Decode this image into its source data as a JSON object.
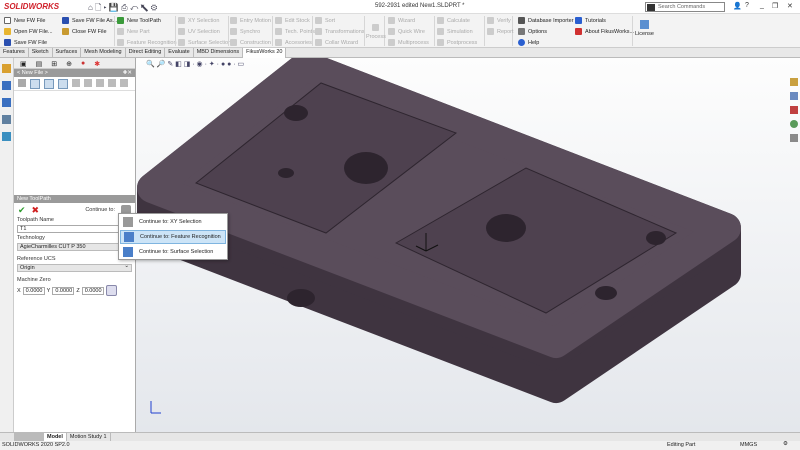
{
  "app": {
    "logo": "SOLIDWORKS",
    "document_title": "592-2931 edited New1.SLDPRT *",
    "search_placeholder": "Search Commands"
  },
  "ribbon": {
    "file": [
      "New FW File",
      "Open FW File...",
      "Save FW File"
    ],
    "file2": [
      "Save FW File As...",
      "Close FW File"
    ],
    "toolpath": [
      "New ToolPath",
      "New Part",
      "Feature Recognition"
    ],
    "selection": [
      "XY Selection",
      "UV Selection",
      "Surface Selection"
    ],
    "motion": [
      "Entry Motion",
      "Synchro",
      "Construction"
    ],
    "stock": [
      "Edit Stock",
      "Tech. Points",
      "Accesories"
    ],
    "sort": [
      "Sort",
      "Transformations",
      "Collar Wizard"
    ],
    "process": "Process",
    "wizard": [
      "Wizard",
      "Quick Wire",
      "Multiprocess"
    ],
    "calc": [
      "Calculate",
      "Simulation",
      "Postprocess"
    ],
    "verify": [
      "Verify",
      "Report"
    ],
    "db": [
      "Database Importer",
      "Options",
      "Help"
    ],
    "tut": [
      "Tutorials",
      "About FikusWorks..."
    ],
    "license": "License"
  },
  "tabs": [
    "Features",
    "Sketch",
    "Surfaces",
    "Mesh Modeling",
    "Direct Editing",
    "Evaluate",
    "MBD Dimensions",
    "FikusWorks 20"
  ],
  "active_tab": "FikusWorks 20",
  "panel": {
    "file_header": "< New File >",
    "toolpath_header": "New ToolPath",
    "continue_label": "Continue to:",
    "toolpath_name_label": "Toolpath Name",
    "toolpath_name_value": "T1",
    "technology_label": "Technology",
    "technology_value": "AgieCharmilles CUT P 350",
    "ucs_label": "Reference UCS",
    "ucs_value": "Origin",
    "machine_zero_label": "Machine Zero",
    "x_label": "X",
    "x_value": "0.0000",
    "y_label": "Y",
    "y_value": "0.0000",
    "z_label": "Z",
    "z_value": "0.0000"
  },
  "menu": {
    "items": [
      "Continue to: XY Selection",
      "Continue to: Feature Recognition",
      "Continue to: Surface Selection"
    ],
    "highlighted": "Continue to: Feature Recognition"
  },
  "bottom_tabs": [
    "Model",
    "Motion Study 1"
  ],
  "status": {
    "version": "SOLIDWORKS 2020 SP2.0",
    "mode": "Editing Part",
    "units": "MMGS"
  },
  "colors": {
    "model": "#4b3f4c",
    "accent": "#d0202a",
    "highlight": "#cce4f7"
  }
}
